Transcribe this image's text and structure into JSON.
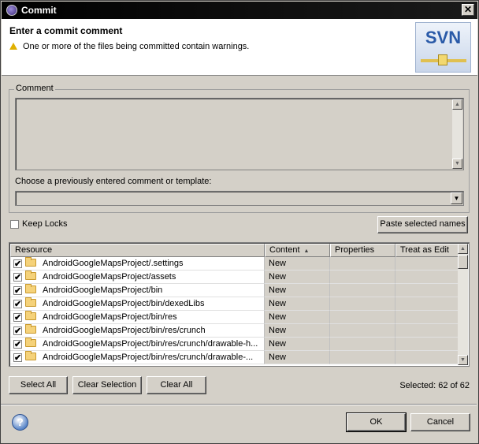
{
  "window": {
    "title": "Commit",
    "close_label": "✕"
  },
  "header": {
    "title": "Enter a commit comment",
    "message": "One or more of the files being committed contain warnings.",
    "logo_text": "SVN"
  },
  "comment": {
    "group_label": "Comment",
    "value": "",
    "template_label": "Choose a previously entered comment or template:",
    "template_value": ""
  },
  "options": {
    "keep_locks_label": "Keep Locks",
    "keep_locks_checked": false,
    "paste_button": "Paste selected names"
  },
  "table": {
    "columns": [
      "Resource",
      "Content",
      "Properties",
      "Treat as Edit"
    ],
    "sort_indicator": "▲",
    "rows": [
      {
        "checked": true,
        "resource": "AndroidGoogleMapsProject/.settings",
        "content": "New",
        "properties": "",
        "treat_as_edit": ""
      },
      {
        "checked": true,
        "resource": "AndroidGoogleMapsProject/assets",
        "content": "New",
        "properties": "",
        "treat_as_edit": ""
      },
      {
        "checked": true,
        "resource": "AndroidGoogleMapsProject/bin",
        "content": "New",
        "properties": "",
        "treat_as_edit": ""
      },
      {
        "checked": true,
        "resource": "AndroidGoogleMapsProject/bin/dexedLibs",
        "content": "New",
        "properties": "",
        "treat_as_edit": ""
      },
      {
        "checked": true,
        "resource": "AndroidGoogleMapsProject/bin/res",
        "content": "New",
        "properties": "",
        "treat_as_edit": ""
      },
      {
        "checked": true,
        "resource": "AndroidGoogleMapsProject/bin/res/crunch",
        "content": "New",
        "properties": "",
        "treat_as_edit": ""
      },
      {
        "checked": true,
        "resource": "AndroidGoogleMapsProject/bin/res/crunch/drawable-h...",
        "content": "New",
        "properties": "",
        "treat_as_edit": ""
      },
      {
        "checked": true,
        "resource": "AndroidGoogleMapsProject/bin/res/crunch/drawable-...",
        "content": "New",
        "properties": "",
        "treat_as_edit": ""
      }
    ]
  },
  "selection": {
    "select_all": "Select All",
    "clear_selection": "Clear Selection",
    "clear_all": "Clear All",
    "status": "Selected: 62 of 62"
  },
  "footer": {
    "help_label": "?",
    "ok": "OK",
    "cancel": "Cancel"
  }
}
